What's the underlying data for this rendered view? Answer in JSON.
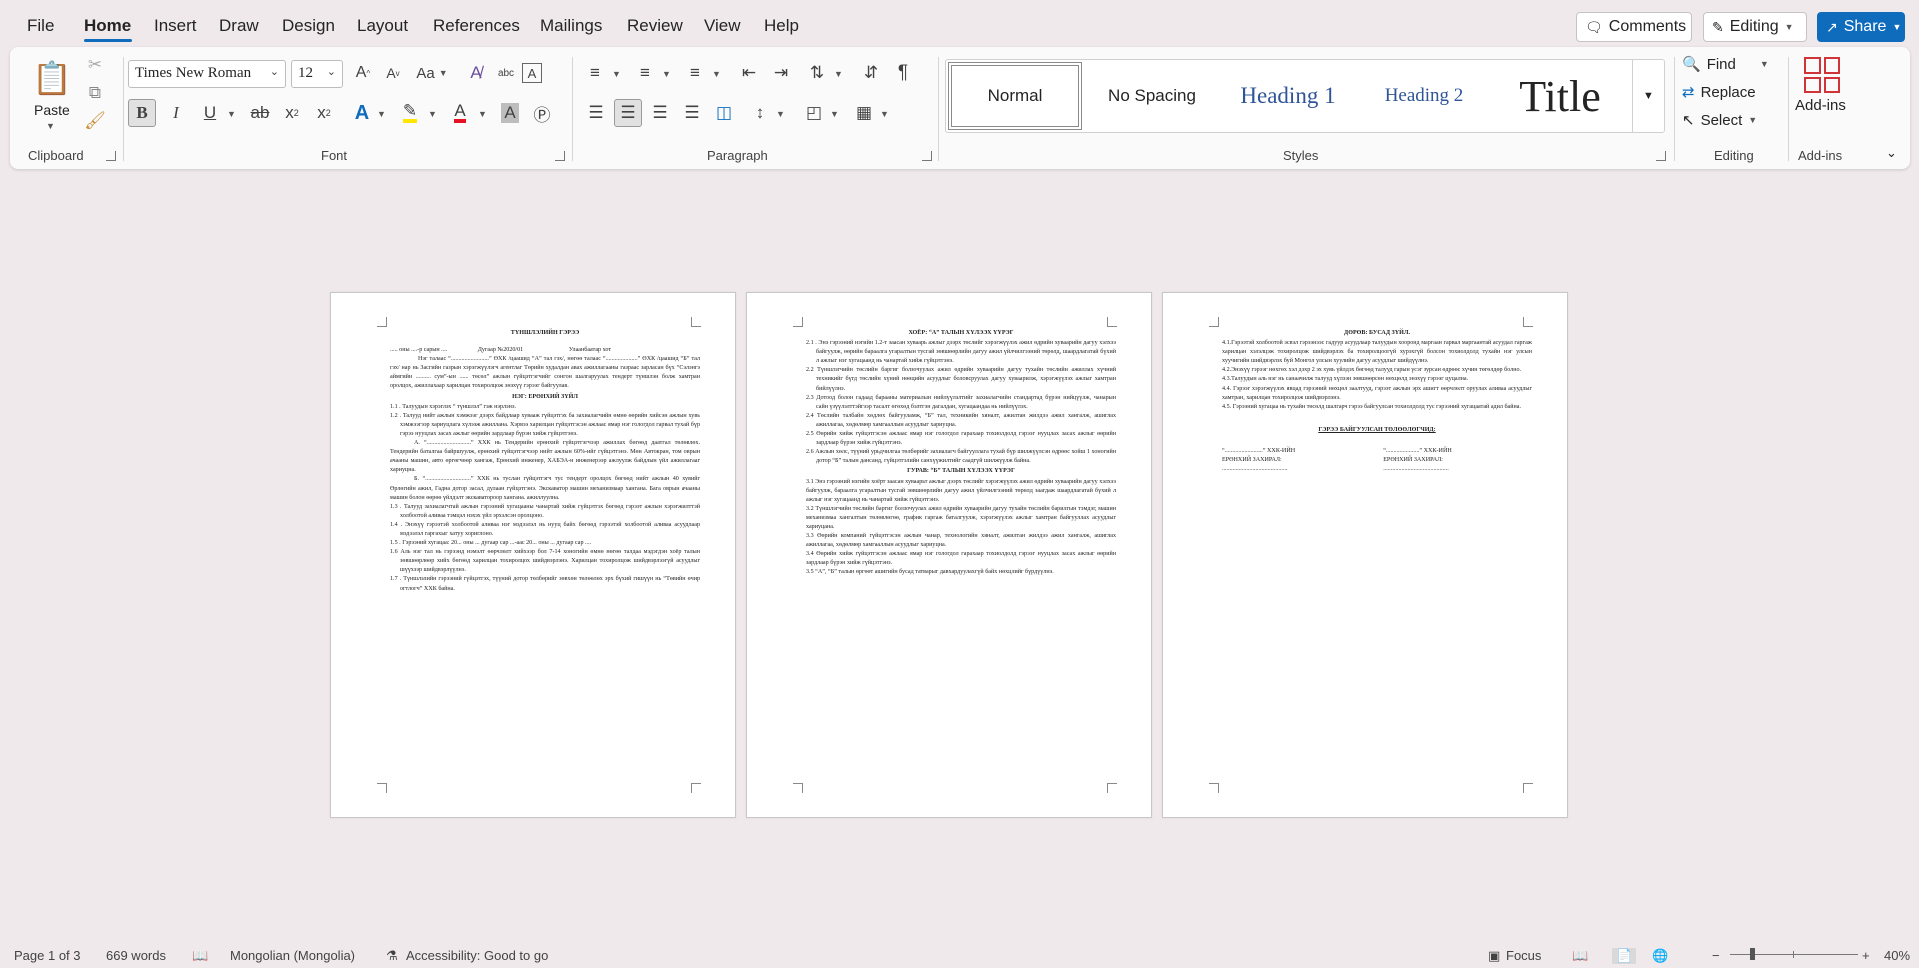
{
  "menu": {
    "file": "File",
    "home": "Home",
    "insert": "Insert",
    "draw": "Draw",
    "design": "Design",
    "layout": "Layout",
    "references": "References",
    "mailings": "Mailings",
    "review": "Review",
    "view": "View",
    "help": "Help"
  },
  "topbar": {
    "comments": "Comments",
    "editing": "Editing",
    "share": "Share"
  },
  "ribbon": {
    "clipboard": {
      "paste": "Paste",
      "label": "Clipboard"
    },
    "font": {
      "name": "Times New Roman",
      "size": "12",
      "label": "Font",
      "case": "Aa"
    },
    "paragraph": {
      "label": "Paragraph"
    },
    "styles": {
      "label": "Styles",
      "items": [
        "Normal",
        "No Spacing",
        "Heading 1",
        "Heading 2",
        "Title"
      ]
    },
    "editing": {
      "find": "Find",
      "replace": "Replace",
      "select": "Select",
      "label": "Editing"
    },
    "addins": {
      "button": "Add-ins",
      "label": "Add-ins"
    }
  },
  "page1": {
    "title": "ТҮНШЛЭЛИЙН ГЭРЭЭ",
    "dateline": "..... оны ....-р сарын ....                    Дугаар №2020/01                              Улаанбаатар хот",
    "intro": "Нэг талаас “.........................” ӨХК /цаашид “А” тал гэх/, нөгөө талаас “.....................” ӨХК /цаашид “Б” тал гэх/ нар нь Засгийн газрын хэрэгжүүлэгч агентлаг Төрийн худалдан авах ажиллагааны газраас зарласан бүх “Сэлэнгэ аймгийн .......... сум”-ын ...... төсөл” ажлын гүйцэтгэгчийг сонгон шалгаруулах тендерт түншлэн болж хамтран оролцох, ажиллахаар харилцан тохиролцож энэхүү гэрээг байгуулав.",
    "h1": "НЭГ: ЕРӨНХИЙ ЗҮЙЛ",
    "p1_1": "1.1 . Талуудын хэрэглэх “ түншлэл” гэж нэрлэнэ.",
    "p1_2": "1.2 . Талууд нийт ажлын хэмжээг дээрх байдлаар хувааж гүйцэтгэх ба захиалагчийн өмнө өөрийн хийсэн ажлын хувь хэмжээгээр хариуцлага хүлээж ажиллана. Хэрвээ харилцан гүйцэтгэсэн ажлаас ямар нэг гологдол гарвал тухай бүр гэрээ нууцлах засах ажлыг өөрийн зардлаар бүрэн хийж гүйцэтгэнэ.",
    "p1_a": "А. “.............................” ХХК нь Тендерийн ерөнхий гүйцэтгэгчээр ажиллах бөгөөд даатгал төлөвлөх. Тендерийн баталгаа байршуулж, ерөнхий гүйцэтгэгчээр нийт ажлын 60%-ийг гүйцэтгэнэ. Мөн Автокран, том оврын ачааны машин, авто өргөгчөөр хангаж, Ерөнхий инженер, ХАБЭА-н инженерээр ажлуулж байдлын үйл ажиллагааг хариуцна.",
    "p1_b": "Б. “..............................” ХХК нь туслан гүйцэтгэгч тус тендерт оролцох бөгөөд нийт ажлын 40 хувийг Өрлөгийн ажил, Гадна дотор засал, дулаан гүйцэтгэнэ. Экскаватор машин механизмаар хангана. Бага оврын ачааны машин болон өөрөө үйлдэлт экскаватороор хангана. ажиллуулна.",
    "p1_3": "1.3 . Талууд захиалагчтай ажлын гэрээний хугацааны чанартай хийж гүйцэтгэх бөгөөд гэрээт ажлын хэрэгжилттэй холбоотой аливаа тэмцэл нэхэх үйл эрхэлсэн оролцоно.",
    "p1_4": "1.4 . Энэхүү гэрээтэй холбоотой аливаа нэг мэдээлэл нь нууц байх бөгөөд гэрээтэй холбоотой аливаа асуудлаар мэдээлэл гаргахыг хатуу хориглоно.",
    "p1_5": "1.5 . Гэрээний хугацаа: 20... оны ... дугаар сар ...-аас 20... оны ... дугаар сар ....",
    "p1_6": "1.6 Аль нэг тал нь гэрээнд нэмэлт өөрчлөлт хийхээр бол 7-14 хоногийн өмнө нөгөө талдаа мэдэгдэн хоёр талын зөвшөөрлөөр хийх бөгөөд харилцан тохиролцох шийдвэрлэнэ. Харилцан тохиролцож шийдвэрлээгүй асуудлыг шүүхээр шийдвэрлүүлнэ.",
    "p1_7": "1.7 . Түншлэлийн гэрээний гүйцэтгэх, түүний дотор төлбөрийг зөвхөн төлөөлөх эрх бүхий гишүүн нь “Төвийн өчир огтлогч” ХХК байна."
  },
  "page2": {
    "h2": "ХОЁР: “А” ТАЛЫН ХҮЛЭЭХ ҮҮРЭГ",
    "p2_1": "2.1 . Энэ гэрээний нэгийн 1.2-т заасан хуваарь ажлыг дээрх төслийг хэрэгжүүлэх ажил өдрийн хуваарийн дагуу хэлхээ байгуулж, өөрийн бараалга угаралтын тусгай зөвшөөрлийн дагуу ажил үйлчилгээний төрөлд, шаардлагатай бүхий л ажлыг нэг хугацаанд нь чанартай хийж гүйцэтгэнэ.",
    "p2_2": "2.2 Түншлэгчийн төслийн баргиг болзочуулах ажил өдрийн хуваарийн дагуу тухайн төслийн ажиллах хүчний техникийг бүгд төслийн хүний нөөцийн асуудлыг боловсруулах дагуу хуваарилж, хэрэгжүүлэх ажлыг хамтран бийлүүлнэ.",
    "p2_3": "2.3 Дотоод болон гадаад барааны материалын нийлүүлэлтийг захиалагчийн стандартад бүрэн нийцүүлж, чанарын сайн үзүүлэлттэйгээр тасалт өгөхөд бэлтгэн дагалдан, хугацаандаа нь нийлүүлэх.",
    "p2_4": "2.4 Төслийн талбайн хөдлөх байгууламж, “Б” тал, техникийн хяналт, ажилтан жилдээ ажил хангалж, ашиглах ажиллагаа, хөдөлмөр хамгааллын асуудлыг хариуцна.",
    "p2_5": "2.5 Өөрийн хийж гүйцэтгэсэн ажлаас ямар нэг гологдол гарахаар тохиолдолд гэрээг нууцлах засах ажлыг өөрийн зардлаар бүрэн хийж гүйцэтгэнэ.",
    "p2_6": "2.6 Ажлын хөлс, түүний урьдчилгаа төлбөрийг захиалагч байгууллага тухай бүр шилжүүлсэн өдрөөс хойш 1 хоногийн дотор “Б” талын дансанд, гүйцэтгэлийн санхүүжилтийг саадгүй шилжүүлж байна.",
    "h3": "ГУРАВ: “Б” ТАЛЫН ХҮЛЭЭХ ҮҮРЭГ",
    "p3_1": "3.1 Энэ гэрээний нэгийн хоёрт заасан хуваарьт ажлыг дээрх төслийг хэрэгжүүлэх ажил өдрийн хуваарийн дагуу хэлхээ байгуулж, бараалга угаралтын тусгай зөвшөөрлийн дагуу ажил үйлчилгээний төрөлд заагдаж шаардлагатай бүхий л ажлыг нэг хугацаанд нь чанартай хийж гүйцэтгэнэ.",
    "p3_2": "3.2 Түншлэгчийн төслийн баргиг болзочуулах ажил өдрийн хуваарийн дагуу тухайн төслийн барилгын тэмдэг, машин механизмаа хангалтын төлөвлөгөө, график гаргаж баталгуулж, хэрэгжүүлэх ажлыг хамтран байгууллах асуудлыг хариуцана.",
    "p3_3": "3.3 Өөрийн компаний гүйцэтгэсэн ажлын чанар, технологийн хяналт, ажилтан жилдээ ажил хангалж, ашиглах ажиллагаа, хөдөлмөр хамгааллын асуудлыг хариуцна.",
    "p3_4": "3.4 Өөрийн хийж гүйцэтгэсэн ажлаас ямар нэг гологдол гарахаар тохиолдолд гэрээг нууцлах засах ажлыг өөрийн зардлаар бүрэн хийж гүйцэтгэнэ.",
    "p3_5": "3.5 “А”, “Б” талын өргөөт ашигийн бусад татварыг давхардуулахгүй байх нөхцлийг бүрдүүлнэ."
  },
  "page3": {
    "h4": "ДӨРӨВ: БУСАД ЗҮЙЛ.",
    "p4_1": "4.1.Гэрээтэй холбоотой эсвэл гэрээнээс гадуур асуудлаар талуудын хооронд маргаан гарвал маргаантай асуудал гаргаж харилцан хэлэлцэж тохиролцож шийдвэрлэх ба тохиролцоогүй хурэхгүй болсон тохиолдолд тухайн нэг улсын хуучигийн шийдвэрлэх буй Монгол улсын хуулийн дагуу асуудлыг шийдүүлнэ.",
    "p4_2": "4.2.Энэхүү гэрээг нөхгөх хэл дэхр 2 эх хувь үйлдэх бөгөөд талууд гарын үсэг зурсан өдрөөс хүчин төгөлдөр болно.",
    "p4_3": "4.3.Талуудын аль нэг нь санаачилж талууд хүлээн зөвшөөрсөн нөхцөлд энэхүү гэрээг цуцална.",
    "p4_4": "4.4. Гэрээг хэрэгжүүлэх явцад гэрээний нөхцөл заалтууд, гэрээт ажлын эрх ашигт өөрчлөлт оруулах аливаа асуудлыг хамтран, харилцан тохиролцож шийдвэрлэнэ.",
    "p4_5": "4.5. Гэрээний хугацаа нь тухайн төсөлд шалгарч гэрээ байгуулсан тохиолдолд тус гэрээний хугацаатай адил байна.",
    "h5": "ГЭРЭЭ БАЙГУУЛСАН ТӨЛӨӨЛӨГЧИД:",
    "sig_left_1": "“.........................” ХХК-ИЙН",
    "sig_left_2": "ЕРӨНХИЙ ЗАХИРАЛ:",
    "sig_left_3": "...........................................",
    "sig_right_1": "“......................” ХХК-ИЙН",
    "sig_right_2": "ЕРӨНХИЙ ЗАХИРАЛ:",
    "sig_right_3": "..........................................."
  },
  "status": {
    "page": "Page 1 of 3",
    "words": "669 words",
    "language": "Mongolian (Mongolia)",
    "accessibility": "Accessibility: Good to go",
    "focus": "Focus",
    "zoom": "40%"
  },
  "colors": {
    "accent": "#0f6cbd",
    "highlight": "#ffe600",
    "fontcolor": "#e81123"
  }
}
